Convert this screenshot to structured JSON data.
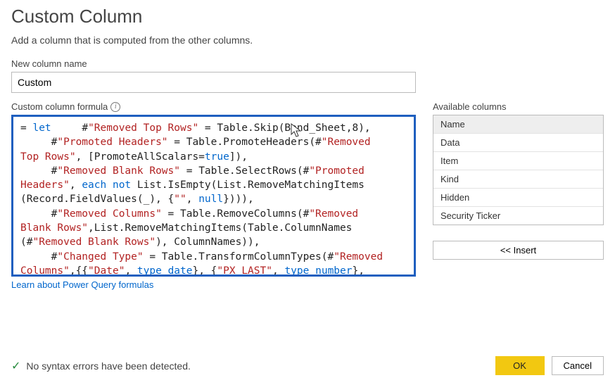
{
  "dialog": {
    "title": "Custom Column",
    "subtitle": "Add a column that is computed from the other columns."
  },
  "newColumn": {
    "label": "New column name",
    "value": "Custom"
  },
  "formula": {
    "label": "Custom column formula",
    "code_tokens": [
      {
        "t": "= "
      },
      {
        "t": "let",
        "c": "kw"
      },
      {
        "t": "     #"
      },
      {
        "t": "\"Removed Top Rows\"",
        "c": "str"
      },
      {
        "t": " = Table.Skip(Bond_Sheet,"
      },
      {
        "t": "8",
        "c": "num"
      },
      {
        "t": "),\n"
      },
      {
        "t": "     #"
      },
      {
        "t": "\"Promoted Headers\"",
        "c": "str"
      },
      {
        "t": " = Table.PromoteHeaders(#"
      },
      {
        "t": "\"Removed\nTop Rows\"",
        "c": "str"
      },
      {
        "t": ", [PromoteAllScalars="
      },
      {
        "t": "true",
        "c": "kw"
      },
      {
        "t": "]),\n"
      },
      {
        "t": "     #"
      },
      {
        "t": "\"Removed Blank Rows\"",
        "c": "str"
      },
      {
        "t": " = Table.SelectRows(#"
      },
      {
        "t": "\"Promoted\nHeaders\"",
        "c": "str"
      },
      {
        "t": ", "
      },
      {
        "t": "each",
        "c": "kw"
      },
      {
        "t": " "
      },
      {
        "t": "not",
        "c": "kw"
      },
      {
        "t": " List.IsEmpty(List.RemoveMatchingItems\n(Record.FieldValues(_), {"
      },
      {
        "t": "\"\"",
        "c": "str"
      },
      {
        "t": ", "
      },
      {
        "t": "null",
        "c": "kw"
      },
      {
        "t": "}))),\n"
      },
      {
        "t": "     #"
      },
      {
        "t": "\"Removed Columns\"",
        "c": "str"
      },
      {
        "t": " = Table.RemoveColumns(#"
      },
      {
        "t": "\"Removed\nBlank Rows\"",
        "c": "str"
      },
      {
        "t": ",List.RemoveMatchingItems(Table.ColumnNames\n(#"
      },
      {
        "t": "\"Removed Blank Rows\"",
        "c": "str"
      },
      {
        "t": "), ColumnNames)),\n"
      },
      {
        "t": "     #"
      },
      {
        "t": "\"Changed Type\"",
        "c": "str"
      },
      {
        "t": " = Table.TransformColumnTypes(#"
      },
      {
        "t": "\"Removed\nColumns\"",
        "c": "str"
      },
      {
        "t": ",{{"
      },
      {
        "t": "\"Date\"",
        "c": "str"
      },
      {
        "t": ", "
      },
      {
        "t": "type",
        "c": "kw"
      },
      {
        "t": " "
      },
      {
        "t": "date",
        "c": "kw"
      },
      {
        "t": "}, {"
      },
      {
        "t": "\"PX_LAST\"",
        "c": "str"
      },
      {
        "t": ", "
      },
      {
        "t": "type",
        "c": "kw"
      },
      {
        "t": " "
      },
      {
        "t": "number",
        "c": "kw"
      },
      {
        "t": "},"
      }
    ],
    "learn_link": "Learn about Power Query formulas"
  },
  "availableColumns": {
    "label": "Available columns",
    "items": [
      {
        "label": "Name",
        "selected": true
      },
      {
        "label": "Data",
        "selected": false
      },
      {
        "label": "Item",
        "selected": false
      },
      {
        "label": "Kind",
        "selected": false
      },
      {
        "label": "Hidden",
        "selected": false
      },
      {
        "label": "Security Ticker",
        "selected": false
      }
    ],
    "insert_label": "<< Insert"
  },
  "status": {
    "message": "No syntax errors have been detected."
  },
  "buttons": {
    "ok": "OK",
    "cancel": "Cancel"
  }
}
